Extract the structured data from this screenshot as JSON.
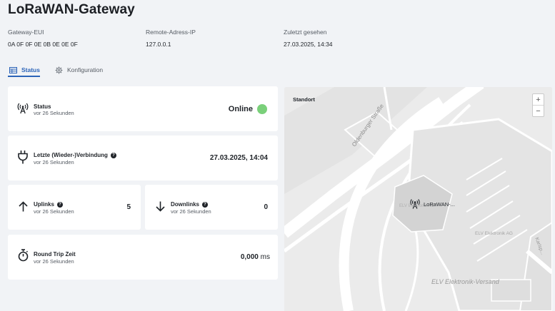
{
  "page": {
    "title": "LoRaWAN-Gateway"
  },
  "meta": [
    {
      "label": "Gateway-EUI",
      "value": "0A 0F 0F 0E 0B 0E 0E 0F"
    },
    {
      "label": "Remote-Adress-IP",
      "value": "127.0.0.1"
    },
    {
      "label": "Zuletzt gesehen",
      "value": "27.03.2025, 14:34"
    }
  ],
  "tabs": [
    {
      "label": "Status",
      "icon": "table-icon",
      "active": true
    },
    {
      "label": "Konfiguration",
      "icon": "gear-icon",
      "active": false
    }
  ],
  "cards": {
    "status": {
      "title": "Status",
      "sub": "vor 26 Sekunden",
      "value": "Online",
      "dot_color": "#7ad07a"
    },
    "connection": {
      "title": "Letzte (Wieder-)Verbindung",
      "sub": "vor 26 Sekunden",
      "value": "27.03.2025, 14:04"
    },
    "uplinks": {
      "title": "Uplinks",
      "sub": "vor 26 Sekunden",
      "value": "5"
    },
    "downlinks": {
      "title": "Downlinks",
      "sub": "vor 26 Sekunden",
      "value": "0"
    },
    "rtt": {
      "title": "Round Trip Zeit",
      "sub": "vor 26 Sekunden",
      "value": "0,000",
      "unit": "ms"
    }
  },
  "map": {
    "title": "Standort",
    "zoom_in": "+",
    "zoom_out": "−",
    "marker_label": "LoRaWAN-...",
    "street_label": "Oldenburger Straße",
    "building_label_1": "ELV Elektronik AG",
    "building_label_2": "ELV Elektronik AG",
    "company_label": "ELV Elektronik-Versand",
    "side_label": "Karlsp..."
  },
  "colors": {
    "accent": "#2b63b8",
    "background": "#f1f3f6",
    "card": "#ffffff",
    "online": "#7ad07a"
  }
}
